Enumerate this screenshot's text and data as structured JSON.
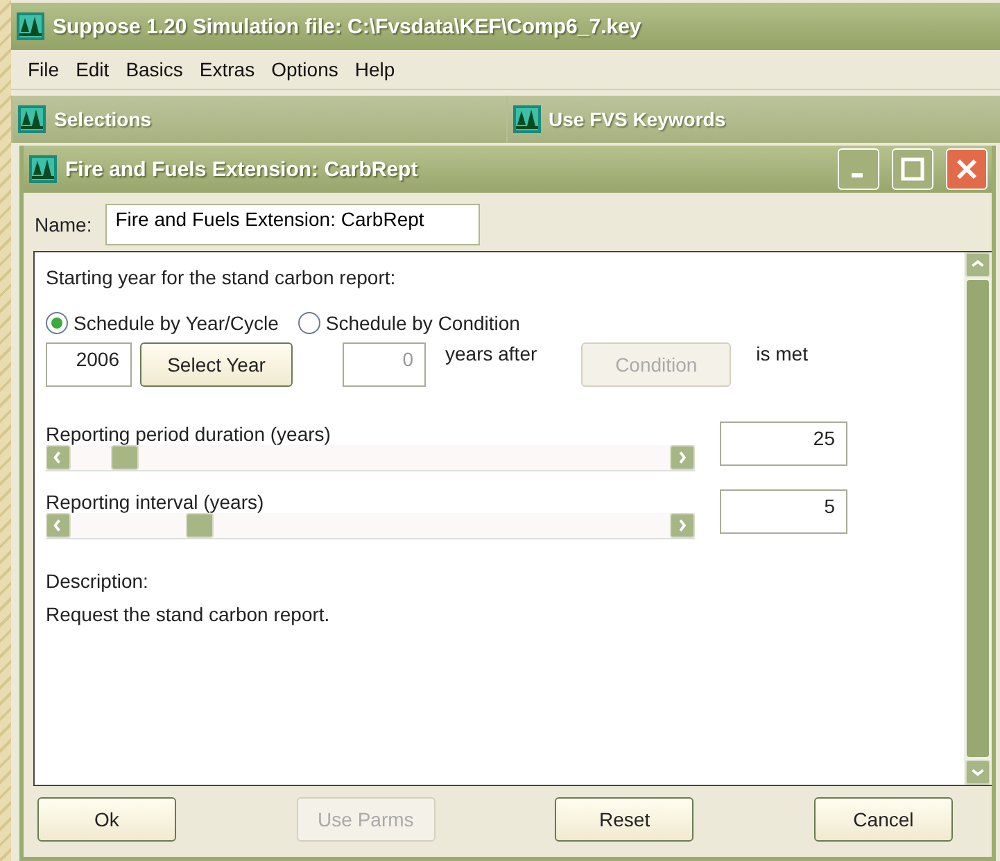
{
  "window": {
    "title": "Suppose 1.20  Simulation file:  C:\\Fvsdata\\KEF\\Comp6_7.key"
  },
  "menu": [
    "File",
    "Edit",
    "Basics",
    "Extras",
    "Options",
    "Help"
  ],
  "panels": [
    {
      "title": "Selections"
    },
    {
      "title": "Use FVS Keywords"
    }
  ],
  "dialog": {
    "title": "Fire and Fuels Extension: CarbRept",
    "name_label": "Name:",
    "name_value": "Fire and Fuels Extension: CarbRept",
    "start_label": "Starting year for the stand carbon report:",
    "radios": [
      {
        "label": "Schedule by Year/Cycle",
        "selected": true
      },
      {
        "label": "Schedule by Condition",
        "selected": false
      }
    ],
    "year_value": "2006",
    "select_year_button": {
      "label": "Select Year",
      "disabled": false
    },
    "years_after_value": "0",
    "years_after_disabled": true,
    "years_after_label": "years after",
    "condition_button": {
      "label": "Condition",
      "disabled": true
    },
    "is_met_label": "is met",
    "sliders": [
      {
        "label": "Reporting period duration (years)",
        "level": 0.07,
        "value": "25"
      },
      {
        "label": "Reporting interval (years)",
        "level": 0.2,
        "value": "5"
      }
    ],
    "description_label": "Description:",
    "description": "Request the stand carbon report.",
    "buttons": [
      {
        "label": "Ok",
        "disabled": false
      },
      {
        "label": "Use Parms",
        "disabled": true
      },
      {
        "label": "Reset",
        "disabled": false
      },
      {
        "label": "Cancel",
        "disabled": false
      }
    ]
  }
}
